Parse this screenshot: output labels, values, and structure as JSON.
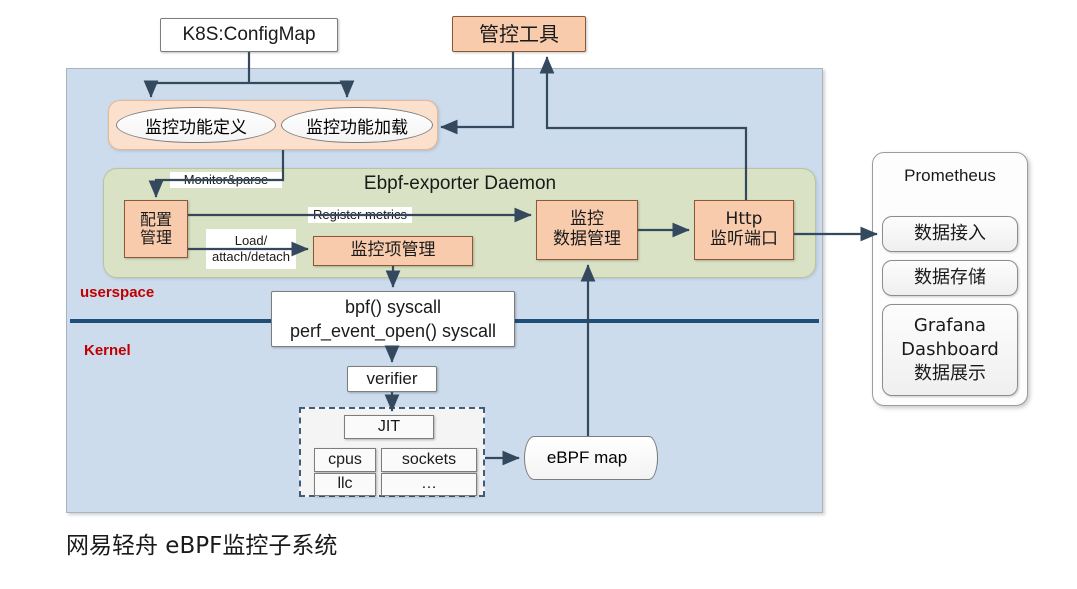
{
  "diagram": {
    "caption": "网易轻舟 eBPF监控子系统",
    "layers": {
      "userspace": "userspace",
      "kernel": "Kernel"
    },
    "colors": {
      "userspace_region": "#ccdcec",
      "daemon_region": "#d9e2c4",
      "orange_node": "#f8cbad",
      "orange_region": "#fbe0cd",
      "layer_label": "#c00000",
      "kernel_divider": "#1f4e79",
      "wire": "#34495e"
    }
  },
  "top": {
    "configmap": "K8S:ConfigMap",
    "control_tool": "管控工具"
  },
  "monitor_group": {
    "define": "监控功能定义",
    "load": "监控功能加载"
  },
  "daemon": {
    "title": "Ebpf-exporter Daemon",
    "config_manage": "配置\n管理",
    "item_manage": "监控项管理",
    "data_manage": "监控\n数据管理",
    "http_port": "Http\n监听端口"
  },
  "edge_labels": {
    "monitor_parse": "Monitor&parse",
    "register_metrics": "Register metrics",
    "load_attach_detach": "Load/\nattach/detach"
  },
  "kernel": {
    "syscall": "bpf() syscall\nperf_event_open() syscall",
    "verifier": "verifier",
    "jit": "JIT",
    "cpus": "cpus",
    "sockets": "sockets",
    "llc": "llc",
    "more": "…",
    "ebpf_map": "eBPF map"
  },
  "prometheus": {
    "title": "Prometheus",
    "items": [
      {
        "label": "数据接入"
      },
      {
        "label": "数据存储"
      },
      {
        "label": "Grafana\nDashboard\n数据展示"
      }
    ]
  }
}
